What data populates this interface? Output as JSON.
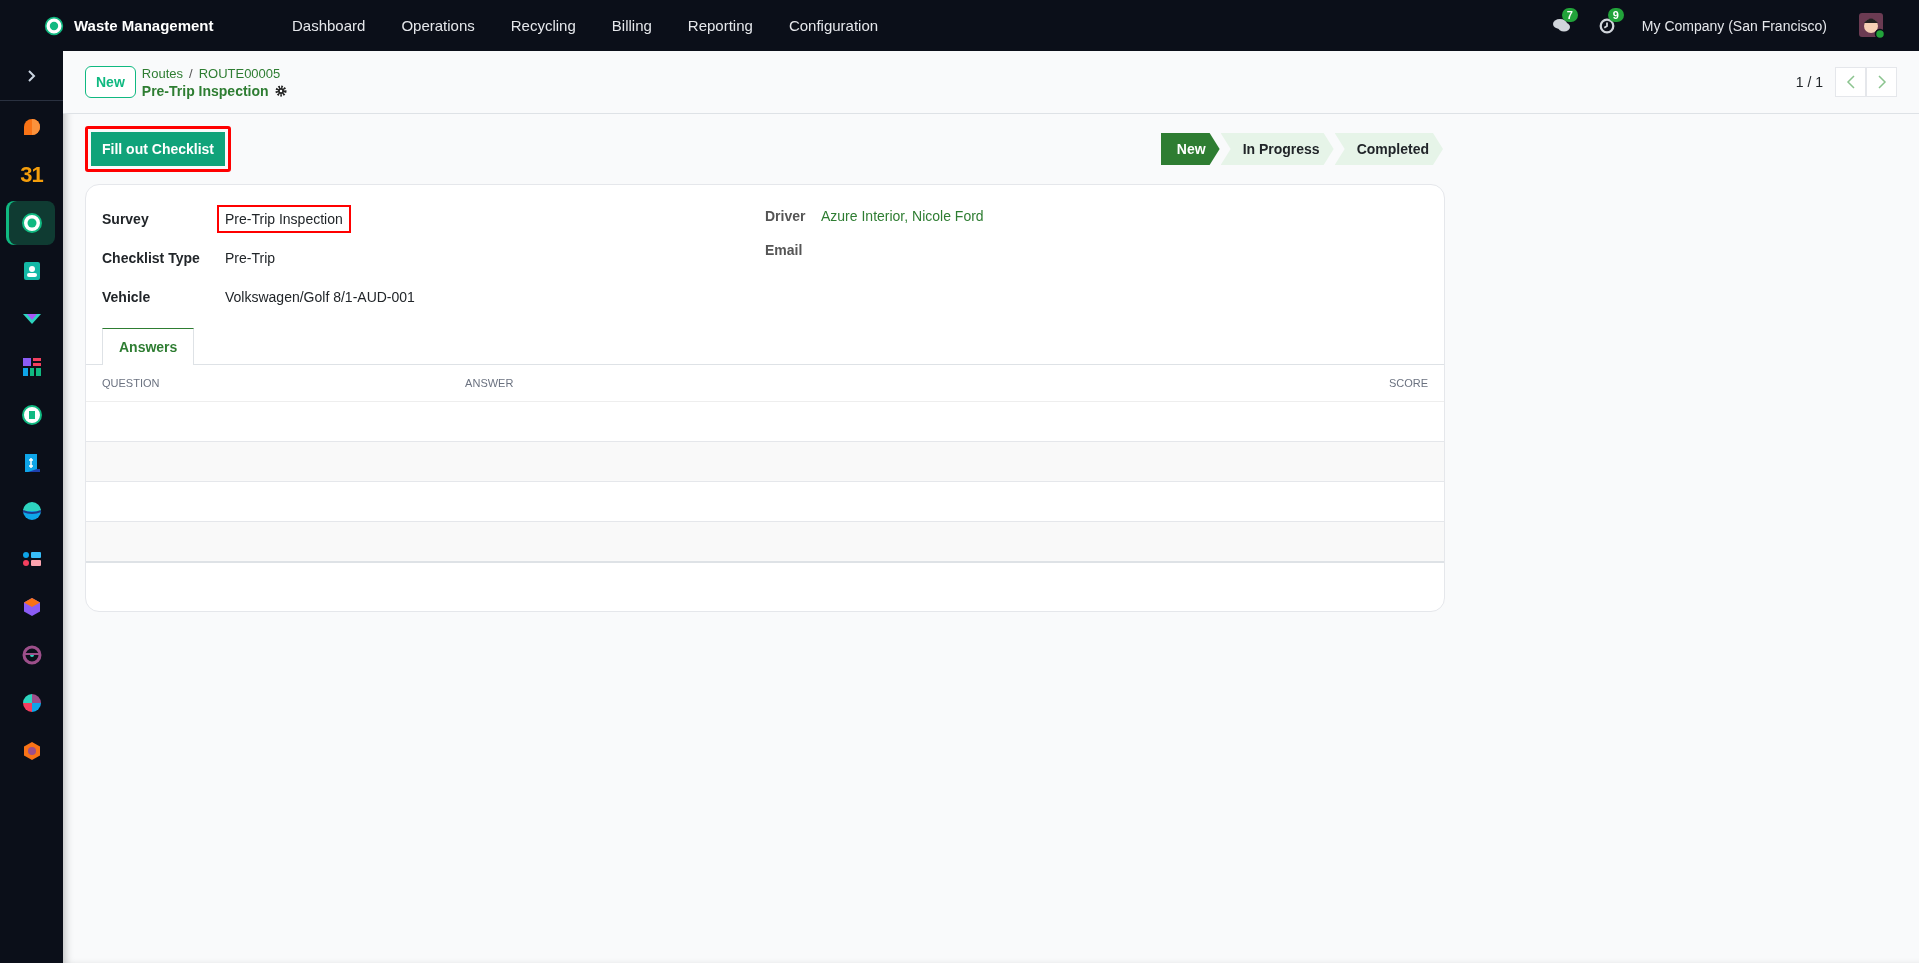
{
  "navbar": {
    "app_name": "Waste Management",
    "menu": [
      "Dashboard",
      "Operations",
      "Recycling",
      "Billing",
      "Reporting",
      "Configuration"
    ],
    "messages_count": "7",
    "activities_count": "9",
    "company": "My Company (San Francisco)"
  },
  "sidebar": {
    "apps": [
      {
        "selected": false
      },
      {
        "selected": false,
        "label": "31"
      },
      {
        "selected": true
      },
      {
        "selected": false
      },
      {
        "selected": false
      },
      {
        "selected": false
      },
      {
        "selected": false
      },
      {
        "selected": false
      },
      {
        "selected": false
      },
      {
        "selected": false
      },
      {
        "selected": false
      },
      {
        "selected": false
      },
      {
        "selected": false
      },
      {
        "selected": false
      }
    ]
  },
  "control_panel": {
    "new_button": "New",
    "breadcrumbs": [
      "Routes",
      "ROUTE00005"
    ],
    "breadcrumb_separator": "/",
    "record_title": "Pre-Trip Inspection",
    "pager": "1 / 1"
  },
  "actions": [
    {
      "label": "Fill out Checklist",
      "highlighted": true
    }
  ],
  "status_steps": [
    {
      "label": "New",
      "selected": true
    },
    {
      "label": "In Progress",
      "selected": false
    },
    {
      "label": "Completed",
      "selected": false
    }
  ],
  "form": {
    "left_fields": [
      {
        "label": "Survey",
        "value": "Pre-Trip Inspection",
        "highlighted": true
      },
      {
        "label": "Checklist Type",
        "value": "Pre-Trip",
        "highlighted": false
      },
      {
        "label": "Vehicle",
        "value": "Volkswagen/Golf 8/1-AUD-001",
        "highlighted": false
      }
    ],
    "right_fields": [
      {
        "label": "Driver",
        "value": "Azure Interior, Nicole Ford",
        "kind": "link"
      },
      {
        "label": "Email",
        "kind": "empty"
      }
    ],
    "tabs": [
      {
        "label": "Answers",
        "selected": true
      }
    ],
    "table": {
      "columns": [
        "QUESTION",
        "ANSWER",
        "SCORE"
      ]
    }
  }
}
